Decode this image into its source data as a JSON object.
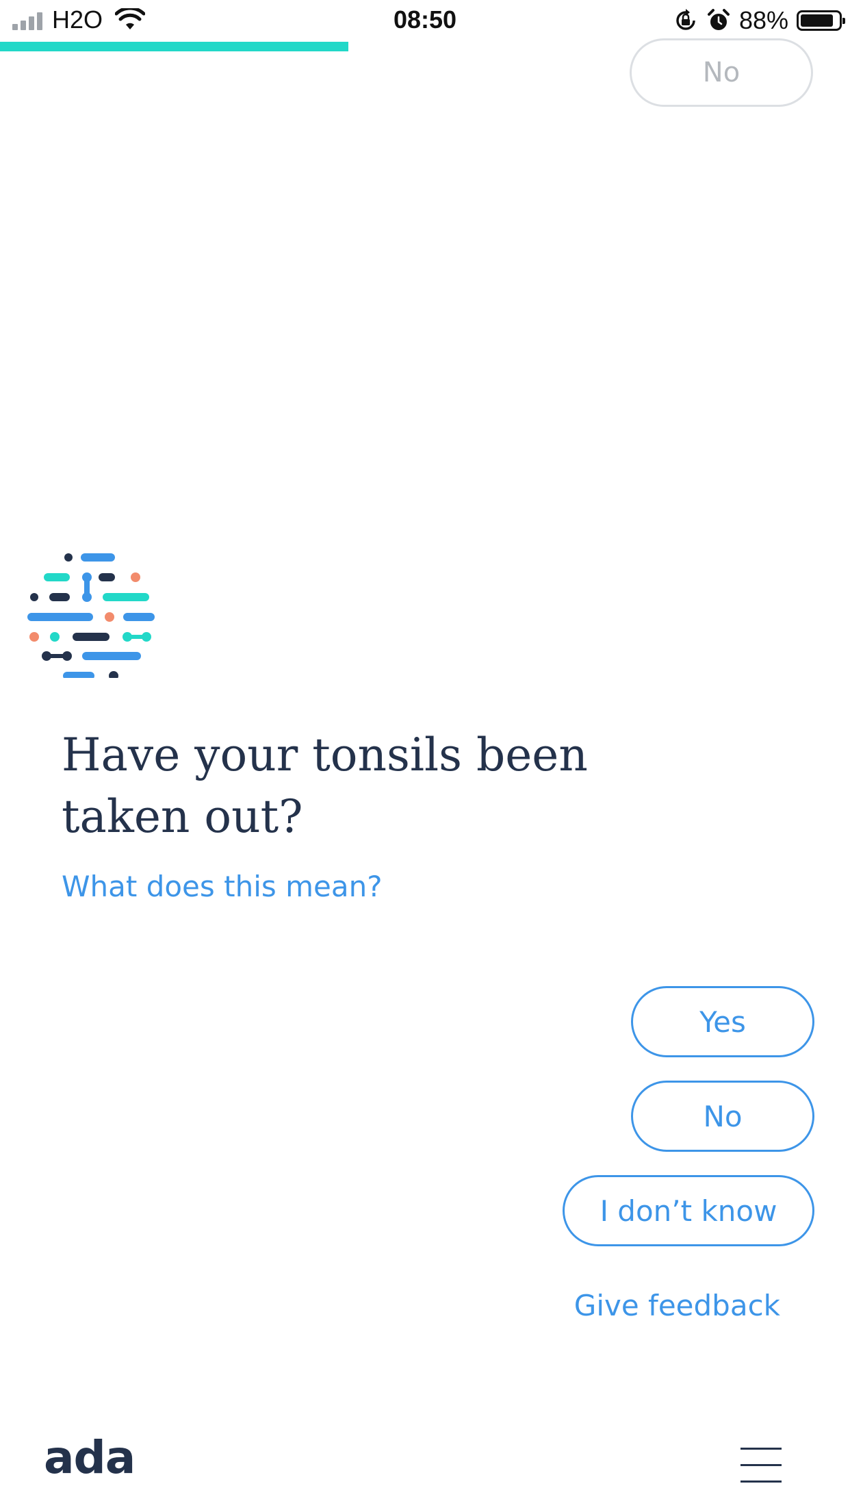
{
  "status_bar": {
    "carrier": "H2O",
    "time": "08:50",
    "battery_percent": "88%",
    "battery_level": 0.88,
    "icons": [
      "signal-icon",
      "wifi-icon",
      "rotation-lock-icon",
      "alarm-icon",
      "battery-icon"
    ]
  },
  "progress": {
    "value": 0.41,
    "color": "#22d8c8"
  },
  "previous_answer": {
    "label": "No"
  },
  "assistant": {
    "avatar_icon": "ada-dots-logo-icon"
  },
  "question": {
    "text": "Have your tonsils been taken out?",
    "help_link": "What does this mean?"
  },
  "answers": {
    "yes_label": "Yes",
    "no_label": "No",
    "idk_label": "I don’t know"
  },
  "feedback": {
    "label": "Give feedback"
  },
  "footer": {
    "logo_text": "ada",
    "menu_icon": "hamburger-menu-icon"
  },
  "colors": {
    "accent_blue": "#3d95e8",
    "navy": "#24324b",
    "teal": "#22d8c8",
    "coral": "#f28b6c"
  }
}
